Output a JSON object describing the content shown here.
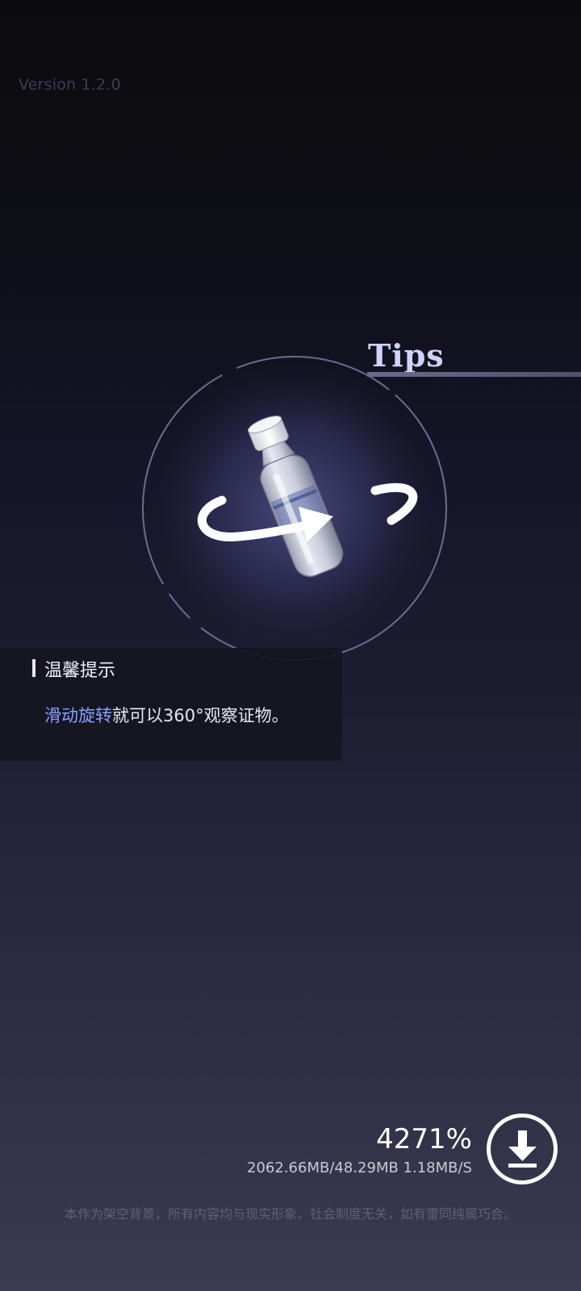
{
  "version": "Version 1.2.0",
  "tips": {
    "title": "Tips",
    "icon": "rotate-bottle-icon",
    "heading": "温馨提示",
    "highlight": "滑动旋转",
    "body_rest": "就可以360°观察证物。"
  },
  "download": {
    "percent": "4271%",
    "sizes": "2062.66MB/48.29MB 1.18MB/S",
    "icon": "download-icon"
  },
  "disclaimer": "本作为架空背景，所有内容均与现实形象、社会制度无关，如有雷同纯属巧合。",
  "colors": {
    "accent": "#8aa0ff",
    "tips_title": "#cfd3ff"
  }
}
